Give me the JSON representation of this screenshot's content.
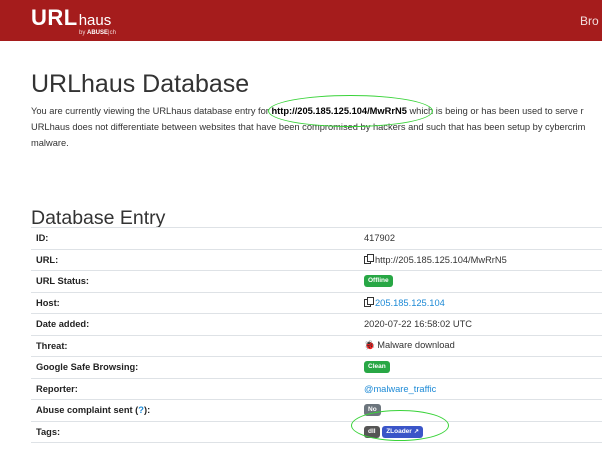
{
  "navbar": {
    "brand_main": "URL",
    "brand_sub": "haus",
    "brand_by": "by",
    "brand_abuse": "ABUSE",
    "brand_ch": "|ch",
    "nav_item": "Bro",
    "background": "#a51c1c"
  },
  "page": {
    "title": "URLhaus Database",
    "intro_part1": "You are currently viewing the URLhaus database entry for ",
    "intro_url": "http://205.185.125.104/MwRrN5",
    "intro_part2": " which is being or has been used to serve r",
    "intro_line2": "URLhaus does not differentiate between websites that have been compromised by hackers and such that has been setup by cybercrim",
    "intro_line3": "malware."
  },
  "entry": {
    "section_title": "Database Entry",
    "rows": {
      "id": {
        "label": "ID:",
        "value": "417902"
      },
      "url": {
        "label": "URL:",
        "value": "http://205.185.125.104/MwRrN5"
      },
      "status": {
        "label": "URL Status:",
        "badge": "Offline",
        "badge_color": "#28a745"
      },
      "host": {
        "label": "Host:",
        "value": "205.185.125.104"
      },
      "date": {
        "label": "Date added:",
        "value": "2020-07-22 16:58:02 UTC"
      },
      "threat": {
        "label": "Threat:",
        "value": "Malware download"
      },
      "gsb": {
        "label": "Google Safe Browsing:",
        "badge": "Clean",
        "badge_color": "#28a745"
      },
      "reporter": {
        "label": "Reporter:",
        "value": "@malware_traffic"
      },
      "abuse": {
        "label_prefix": "Abuse complaint sent (",
        "label_link": "?",
        "label_suffix": "):",
        "badge": "No",
        "badge_color": "#6c757d"
      },
      "tags": {
        "label": "Tags:",
        "tag1": "dll",
        "tag1_color": "#555555",
        "tag2": "ZLoader",
        "tag2_color": "#3a55c8"
      }
    }
  },
  "icons": [
    "copy-icon",
    "bug-icon",
    "external-link-icon"
  ],
  "annotation_color": "#39d339"
}
